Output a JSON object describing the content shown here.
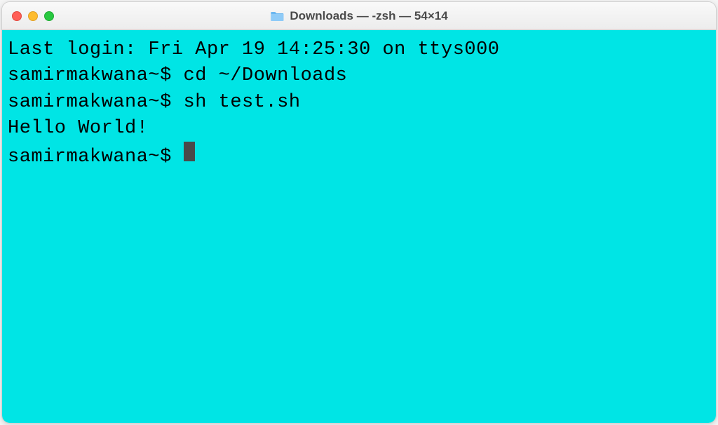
{
  "window": {
    "title": "Downloads — -zsh — 54×14"
  },
  "terminal": {
    "last_login": "Last login: Fri Apr 19 14:25:30 on ttys000",
    "prompt_user": "samirmakwana",
    "lines": [
      {
        "prompt": "samirmakwana~$ ",
        "command": "cd ~/Downloads"
      },
      {
        "prompt": "samirmakwana~$ ",
        "command": "sh test.sh"
      }
    ],
    "output": "Hello World!",
    "current_prompt": "samirmakwana~$ "
  },
  "colors": {
    "terminal_bg": "#00e5e5",
    "text": "#000000"
  }
}
